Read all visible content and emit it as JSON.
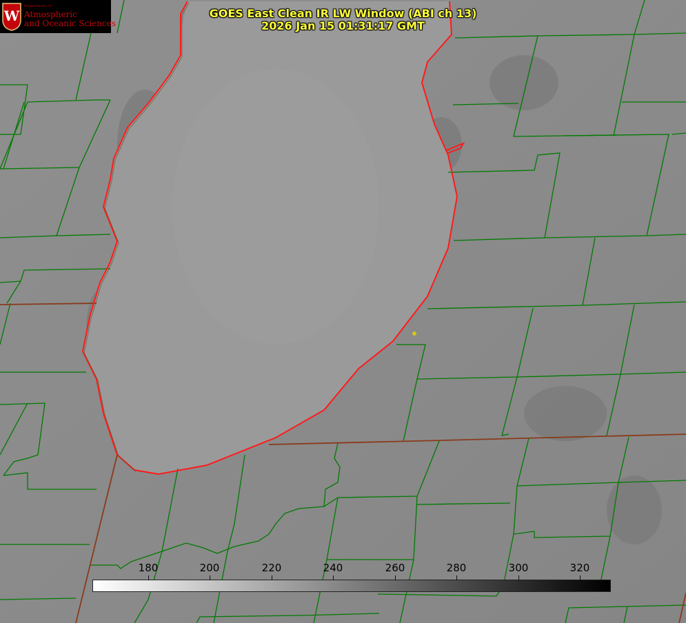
{
  "title": {
    "line1": "GOES East Clean IR LW Window (ABI ch 13)",
    "line2": "2026 Jan 15 01:31:17 GMT"
  },
  "logo": {
    "department": "Department of",
    "line1": "Atmospheric",
    "line2": "and Oceanic Sciences",
    "seal_letter": "W"
  },
  "colorbar": {
    "min": 162,
    "max": 330,
    "tick_labels": [
      "180",
      "200",
      "220",
      "240",
      "260",
      "280",
      "300",
      "320"
    ],
    "tick_values": [
      180,
      200,
      220,
      240,
      260,
      280,
      300,
      320
    ],
    "color_low": "#ffffff",
    "color_high": "#000000"
  },
  "colors": {
    "county_lines": "#007a00",
    "state_lines": "#8a3a1a",
    "coastline": "#ff1a1a",
    "title_text": "#ffff3a",
    "logo_accent": "#c5050c",
    "marker": "#d6c41a"
  }
}
